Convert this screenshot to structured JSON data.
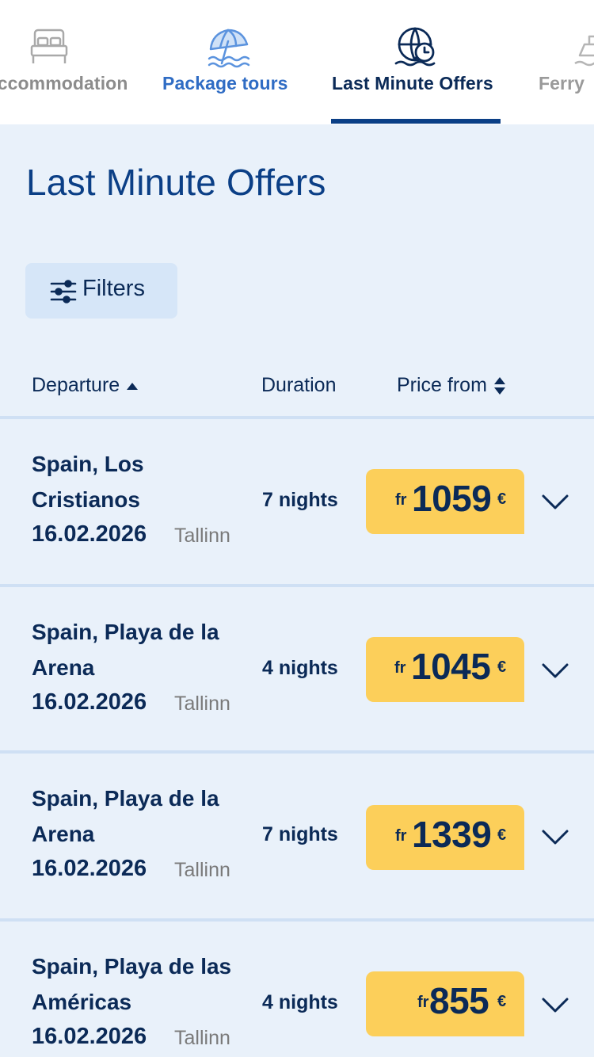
{
  "tabs": [
    {
      "label": "Accommodation",
      "icon": "bed-icon"
    },
    {
      "label": "Package tours",
      "icon": "beach-umbrella-icon"
    },
    {
      "label": "Last Minute Offers",
      "icon": "clock-globe-icon"
    },
    {
      "label": "Ferry",
      "icon": "ship-icon"
    }
  ],
  "page": {
    "title": "Last Minute Offers"
  },
  "filters": {
    "label": "Filters"
  },
  "columns": {
    "departure": "Departure",
    "duration": "Duration",
    "price": "Price from"
  },
  "offers": [
    {
      "destination": "Spain, Los Cristianos",
      "date": "16.02.2026",
      "city": "Tallinn",
      "nights": "7 nights",
      "price_prefix": "fr",
      "price": "1059",
      "currency": "€"
    },
    {
      "destination": "Spain, Playa de la Arena",
      "date": "16.02.2026",
      "city": "Tallinn",
      "nights": "4 nights",
      "price_prefix": "fr",
      "price": "1045",
      "currency": "€"
    },
    {
      "destination": "Spain, Playa de la Arena",
      "date": "16.02.2026",
      "city": "Tallinn",
      "nights": "7 nights",
      "price_prefix": "fr",
      "price": "1339",
      "currency": "€"
    },
    {
      "destination": "Spain, Playa de las Américas",
      "date": "16.02.2026",
      "city": "Tallinn",
      "nights": "4 nights",
      "price_prefix": "fr",
      "price": "855",
      "currency": "€"
    }
  ],
  "colors": {
    "brand_dark": "#0b2a57",
    "brand_blue": "#0b3f86",
    "accent_blue": "#2f6cc4",
    "price_yellow": "#fccf5a",
    "background": "#e9f1fa"
  }
}
